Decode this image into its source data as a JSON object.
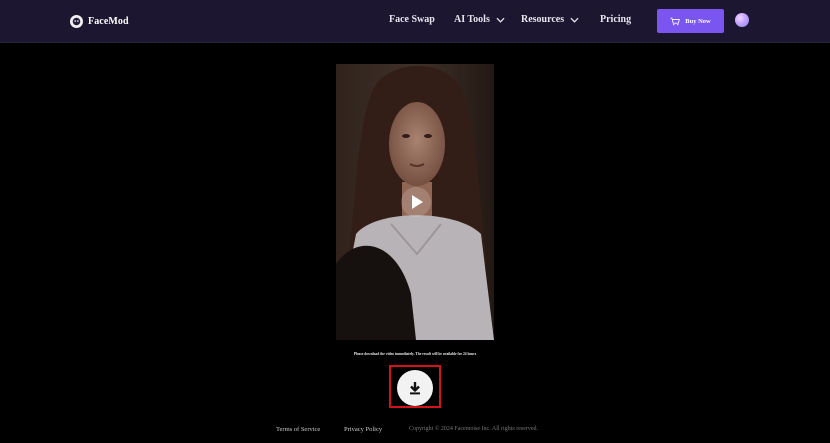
{
  "nav": {
    "logo_text": "FaceMod",
    "items": [
      {
        "label": "Face Swap"
      },
      {
        "label": "AI Tools"
      },
      {
        "label": "Resources"
      },
      {
        "label": "Pricing"
      }
    ],
    "buy_label": "Buy Now"
  },
  "notice": "Please download the video immediately. The result will be available for 24 hours",
  "footer": {
    "terms": "Terms of Service",
    "privacy": "Privacy Policy",
    "copyright": "Copyright © 2024 Facemoise Inc. All rights reserved."
  },
  "colors": {
    "nav_bg": "#1c1630",
    "accent": "#7b55f0",
    "highlight": "#d2141a",
    "page_bg": "#000000"
  },
  "icons": {
    "play": "play-icon",
    "download": "download-icon",
    "cart": "cart-icon",
    "chevron": "chevron-down-icon"
  }
}
